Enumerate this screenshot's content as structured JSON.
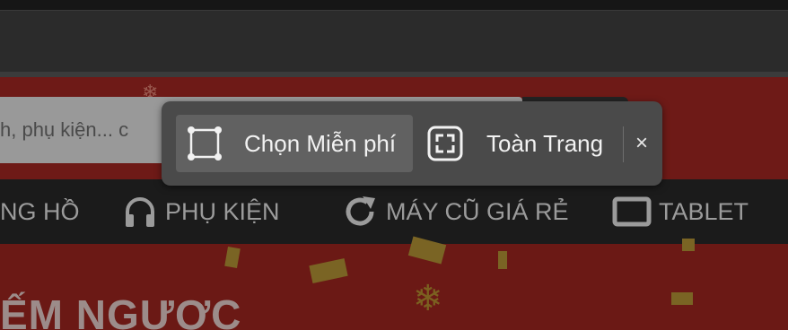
{
  "page": {
    "search_placeholder": "h, phụ kiện... c",
    "nav_items": [
      {
        "label": "NG HỒ",
        "icon": "none"
      },
      {
        "label": "PHỤ KIỆN",
        "icon": "headphones-icon"
      },
      {
        "label": "MÁY CŨ GIÁ RẺ",
        "icon": "refresh-icon"
      },
      {
        "label": "TABLET",
        "icon": "tablet-icon"
      }
    ],
    "promo_title": "ẾM NGƯỢC"
  },
  "toolbar": {
    "select_free_label": "Chọn Miễn phí",
    "full_page_label": "Toàn Trang",
    "close_label": "×"
  },
  "colors": {
    "toolbar_bg": "#4a4a4a",
    "toolbar_selected_bg": "#616161",
    "page_red": "#6c1a16",
    "nav_bg": "#1b1b1b"
  }
}
